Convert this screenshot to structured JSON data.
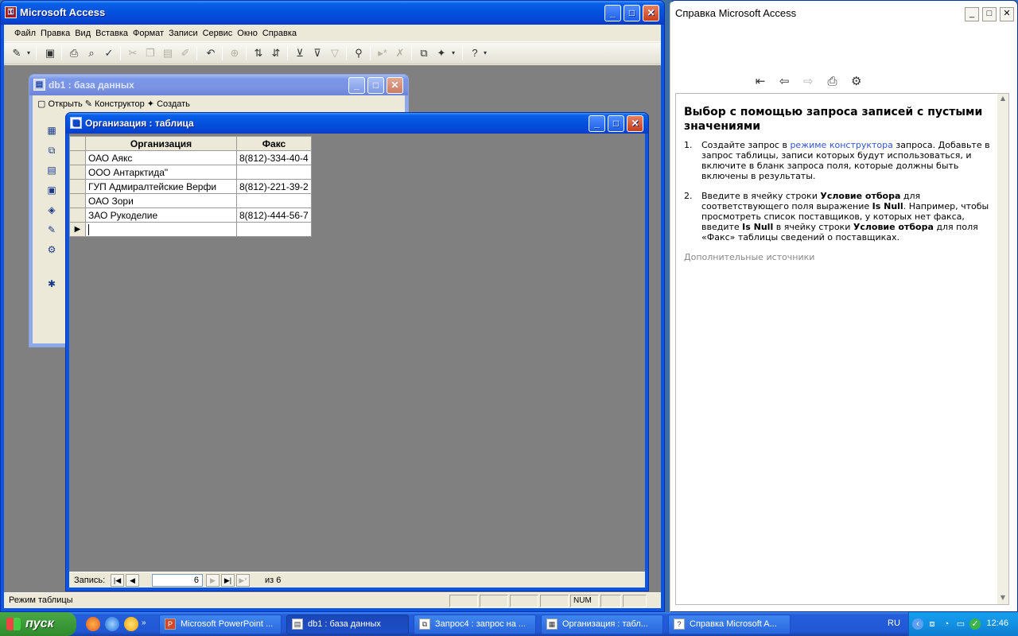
{
  "access": {
    "title": "Microsoft Access",
    "menu": [
      "Файл",
      "Правка",
      "Вид",
      "Вставка",
      "Формат",
      "Записи",
      "Сервис",
      "Окно",
      "Справка"
    ],
    "status_text": "Режим таблицы",
    "status_num": "NUM"
  },
  "db1": {
    "title": "db1 : база данных",
    "toolbar": {
      "open": "Открыть",
      "design": "Конструктор",
      "create": "Создать"
    }
  },
  "table": {
    "title": "Организация : таблица",
    "columns": [
      "Организация",
      "Факс"
    ],
    "rows": [
      [
        "ОАО Аякс",
        "8(812)-334-40-4"
      ],
      [
        "ООО Антарктида\"",
        ""
      ],
      [
        "ГУП Адмиралтейские Верфи",
        "8(812)-221-39-2"
      ],
      [
        "ОАО Зори",
        ""
      ],
      [
        "ЗАО Рукоделие",
        "8(812)-444-56-7"
      ]
    ],
    "nav": {
      "label": "Запись:",
      "current": "6",
      "of_label": "из 6"
    }
  },
  "help": {
    "title": "Справка Microsoft Access",
    "heading": "Выбор с помощью запроса записей с пустыми значениями",
    "step1": {
      "num": "1.",
      "before": "Создайте запрос в ",
      "link": "режиме конструктора",
      "after": " запроса. Добавьте в запрос таблицы, записи которых будут использоваться, и включите в бланк запроса поля, которые должны быть включены в результаты."
    },
    "step2": {
      "num": "2.",
      "t1": "Введите в ячейку строки ",
      "b1": "Условие отбора",
      "t2": " для соответствующего поля выражение ",
      "b2": "Is Null",
      "t3": ". Например, чтобы просмотреть список поставщиков, у которых нет факса, введите ",
      "b3": "Is Null",
      "t4": " в ячейку строки ",
      "b4": "Условие отбора",
      "t5": " для поля «Факс» таблицы сведений о поставщиках."
    },
    "more": "Дополнительные источники"
  },
  "taskbar": {
    "start": "пуск",
    "tasks": [
      "Microsoft PowerPoint ...",
      "db1 : база данных",
      "Запрос4 : запрос на ...",
      "Организация : табл...",
      "Справка Microsoft A..."
    ],
    "lang": "RU",
    "clock": "12:46"
  }
}
